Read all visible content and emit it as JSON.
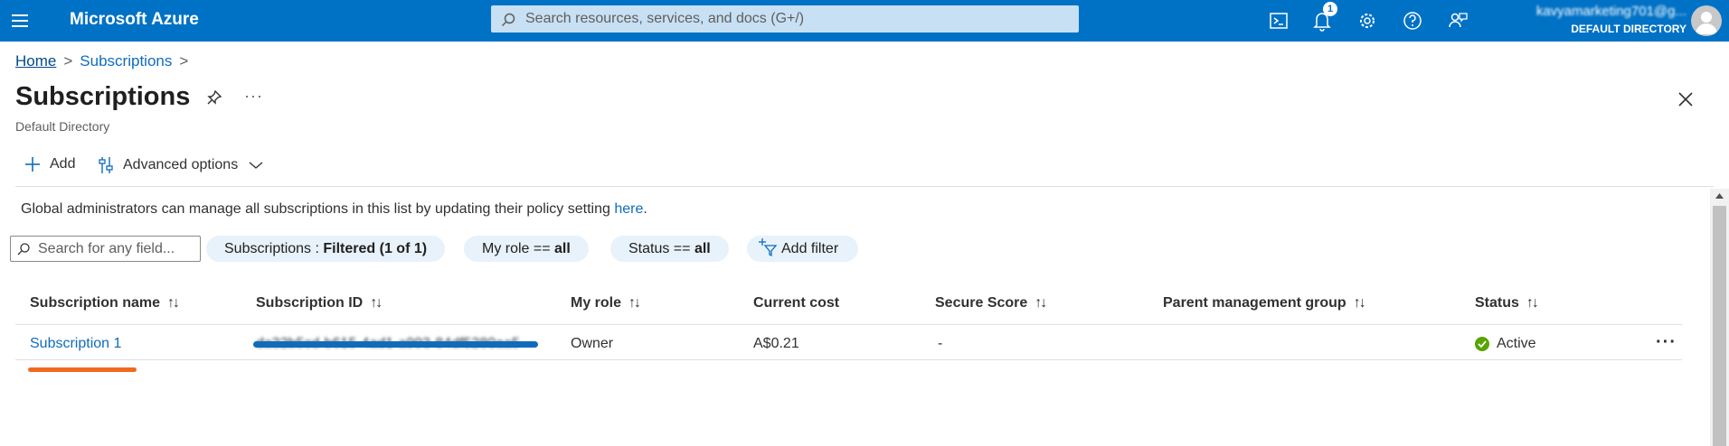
{
  "topbar": {
    "brand": "Microsoft Azure",
    "search_placeholder": "Search resources, services, and docs (G+/)",
    "notification_count": "1",
    "account_name": "kavyamarketing701@g...",
    "account_directory": "DEFAULT DIRECTORY",
    "icons": [
      "hamburger-icon",
      "search-icon",
      "cloud-shell-icon",
      "bell-icon",
      "gear-icon",
      "help-icon",
      "feedback-icon",
      "avatar"
    ],
    "colors": {
      "bar": "#0072c6",
      "search": "#c7e0f4"
    }
  },
  "breadcrumb": {
    "home": "Home",
    "current": "Subscriptions",
    "separator": ">"
  },
  "page": {
    "title": "Subscriptions",
    "subtitle": "Default Directory",
    "more": "···"
  },
  "commands": {
    "add": "Add",
    "advanced": "Advanced options"
  },
  "info": {
    "text": "Global administrators can manage all subscriptions in this list by updating their policy setting ",
    "link": "here",
    "end": "."
  },
  "filters": {
    "search_placeholder": "Search for any field...",
    "pills": [
      {
        "label": "Subscriptions : ",
        "value": "Filtered (1 of 1)"
      },
      {
        "label": "My role == ",
        "value": "all"
      },
      {
        "label": "Status == ",
        "value": "all"
      }
    ],
    "add_filter": "Add filter"
  },
  "table": {
    "columns": [
      "Subscription name",
      "Subscription ID",
      "My role",
      "Current cost",
      "Secure Score",
      "Parent management group",
      "Status"
    ],
    "sort_glyph": "↑↓",
    "rows": [
      {
        "name": "Subscription 1",
        "id": "da32b5cd-b615-4ad1-a993-84df5280aa5",
        "role": "Owner",
        "cost": "A$0.21",
        "secure_score": "-",
        "parent_group": "",
        "status": "Active",
        "more": "···"
      }
    ]
  },
  "annotations": {
    "redaction_color": "#0f6cbd",
    "highlight_color": "#f06a1f"
  }
}
